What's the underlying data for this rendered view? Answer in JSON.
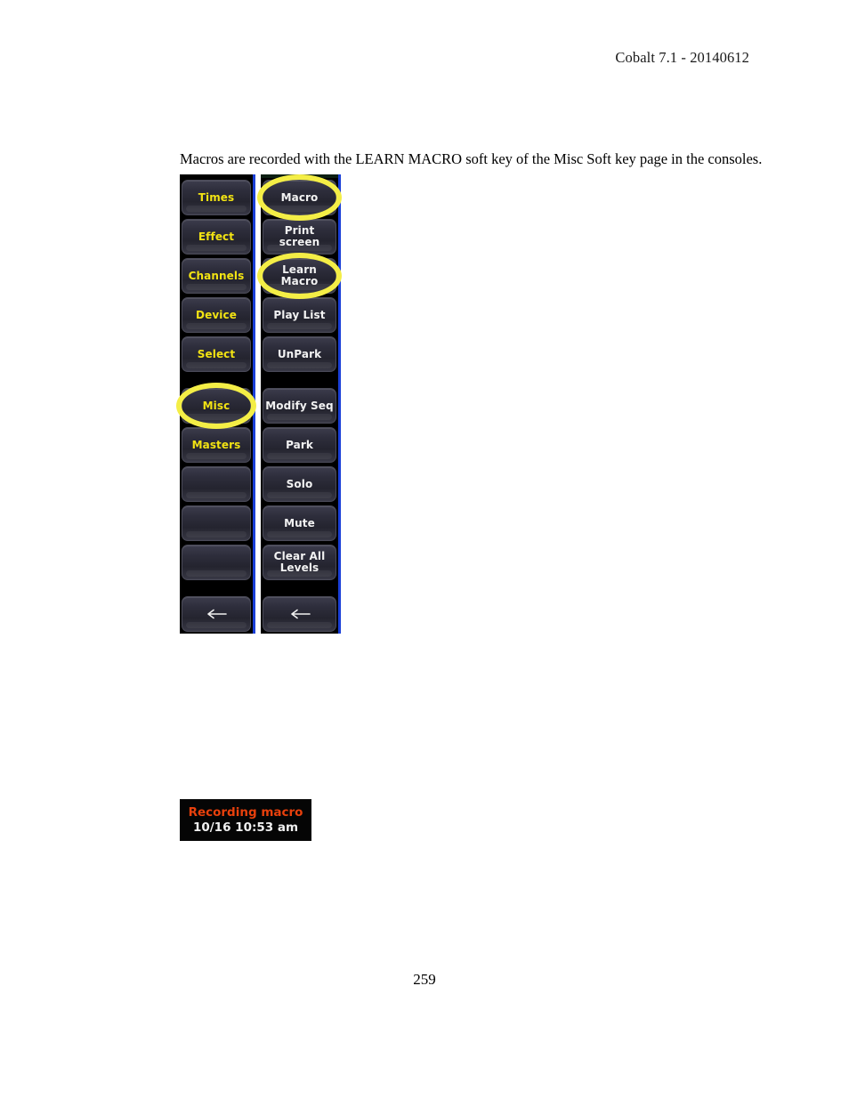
{
  "header": {
    "product_version": "Cobalt 7.1 - 20140612"
  },
  "body": {
    "intro_paragraph": "Macros are recorded with the LEARN MACRO soft key of the Misc Soft key page in the consoles."
  },
  "figure": {
    "left_column": {
      "name": "softkey-page-column",
      "text_color": "#f2e313",
      "border_color": "#1a3fd8",
      "keys": [
        {
          "label": "Times",
          "highlighted": false,
          "blank": false
        },
        {
          "label": "Effect",
          "highlighted": false,
          "blank": false
        },
        {
          "label": "Channels",
          "highlighted": false,
          "blank": false
        },
        {
          "label": "Device",
          "highlighted": false,
          "blank": false
        },
        {
          "label": "Select",
          "highlighted": false,
          "blank": false
        },
        {
          "label": "Misc",
          "highlighted": true,
          "blank": false
        },
        {
          "label": "Masters",
          "highlighted": false,
          "blank": false
        },
        {
          "label": "",
          "highlighted": false,
          "blank": true
        },
        {
          "label": "",
          "highlighted": false,
          "blank": true
        },
        {
          "label": "",
          "highlighted": false,
          "blank": true
        },
        {
          "label": "",
          "highlighted": false,
          "blank": false,
          "icon": "back-arrow-icon"
        }
      ]
    },
    "right_column": {
      "name": "misc-softkey-column",
      "text_color": "#f2f2f2",
      "border_color": "#1a3fd8",
      "keys": [
        {
          "label": "Macro",
          "highlighted": true,
          "blank": false
        },
        {
          "label": "Print screen",
          "highlighted": false,
          "blank": false
        },
        {
          "label": "Learn\nMacro",
          "highlighted": true,
          "blank": false
        },
        {
          "label": "Play List",
          "highlighted": false,
          "blank": false
        },
        {
          "label": "UnPark",
          "highlighted": false,
          "blank": false
        },
        {
          "label": "Modify Seq",
          "highlighted": false,
          "blank": false
        },
        {
          "label": "Park",
          "highlighted": false,
          "blank": false
        },
        {
          "label": "Solo",
          "highlighted": false,
          "blank": false
        },
        {
          "label": "Mute",
          "highlighted": false,
          "blank": false
        },
        {
          "label": "Clear All\nLevels",
          "highlighted": false,
          "blank": false
        },
        {
          "label": "",
          "highlighted": false,
          "blank": false,
          "icon": "back-arrow-icon"
        }
      ]
    },
    "highlight_color": "#f4ee46"
  },
  "recording_readout": {
    "title": "Recording macro",
    "timestamp": "10/16 10:53 am",
    "title_color": "#e8400c",
    "timestamp_color": "#f0f0f0",
    "background_color": "#050505"
  },
  "footer": {
    "page_number": "259"
  }
}
